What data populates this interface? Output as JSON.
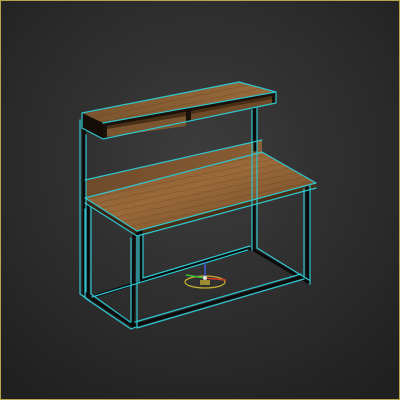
{
  "viewport": {
    "background_top": "#3a3a3a",
    "background_bottom": "#232323",
    "active_border_color": "#b8a44c"
  },
  "selection": {
    "highlight_color": "#2ec6d0"
  },
  "model": {
    "wood_light": "#9a6a3a",
    "wood_dark": "#5a3a1e",
    "metal_color": "#0b0b0b"
  },
  "gizmo": {
    "icon": "transform-gizmo-icon",
    "x_axis_color": "#d23a2a",
    "y_axis_color": "#3ac23a",
    "z_axis_color": "#3a5ad2"
  }
}
